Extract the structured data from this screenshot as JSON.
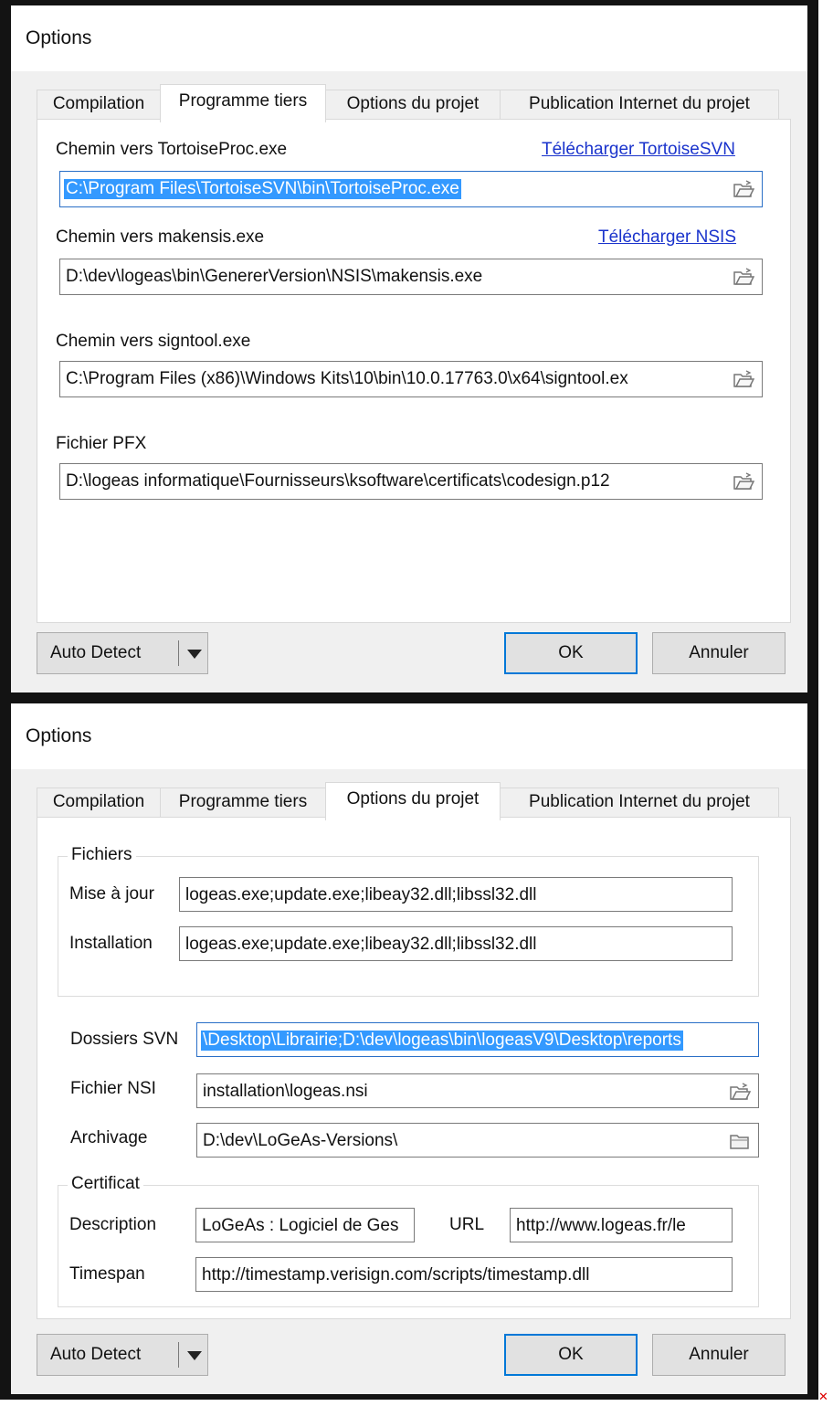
{
  "windows": [
    {
      "title": "Options",
      "tabs": [
        "Compilation",
        "Programme tiers",
        "Options du projet",
        "Publication Internet du projet"
      ],
      "active_tab": "Programme tiers",
      "fields": [
        {
          "label": "Chemin vers TortoiseProc.exe",
          "link": "Télécharger TortoiseSVN",
          "value": "C:\\Program Files\\TortoiseSVN\\bin\\TortoiseProc.exe",
          "icon": "open-file-icon"
        },
        {
          "label": "Chemin vers makensis.exe",
          "link": "Télécharger NSIS",
          "value": "D:\\dev\\logeas\\bin\\GenererVersion\\NSIS\\makensis.exe",
          "icon": "open-file-icon"
        },
        {
          "label": "Chemin vers signtool.exe",
          "value": "C:\\Program Files (x86)\\Windows Kits\\10\\bin\\10.0.17763.0\\x64\\signtool.ex",
          "icon": "open-file-icon"
        },
        {
          "label": "Fichier PFX",
          "value": "D:\\logeas informatique\\Fournisseurs\\ksoftware\\certificats\\codesign.p12",
          "icon": "open-file-icon"
        }
      ],
      "buttons": {
        "auto_detect": "Auto Detect",
        "ok": "OK",
        "cancel": "Annuler"
      }
    },
    {
      "title": "Options",
      "tabs": [
        "Compilation",
        "Programme tiers",
        "Options du projet",
        "Publication Internet du projet"
      ],
      "active_tab": "Options du projet",
      "fichiers": {
        "title": "Fichiers",
        "mise_a_jour_label": "Mise à jour",
        "mise_a_jour_value": "logeas.exe;update.exe;libeay32.dll;libssl32.dll",
        "installation_label": "Installation",
        "installation_value": "logeas.exe;update.exe;libeay32.dll;libssl32.dll"
      },
      "dossiers_svn_label": "Dossiers SVN",
      "dossiers_svn_value": "\\Desktop\\Librairie;D:\\dev\\logeas\\bin\\logeasV9\\Desktop\\reports",
      "fichier_nsi_label": "Fichier NSI",
      "fichier_nsi_value": "installation\\logeas.nsi",
      "archivage_label": "Archivage",
      "archivage_value": "D:\\dev\\LoGeAs-Versions\\",
      "certificat": {
        "title": "Certificat",
        "description_label": "Description",
        "description_value": "LoGeAs : Logiciel de Ges",
        "url_label": "URL",
        "url_value": "http://www.logeas.fr/le",
        "timespan_label": "Timespan",
        "timespan_value": "http://timestamp.verisign.com/scripts/timestamp.dll"
      },
      "buttons": {
        "auto_detect": "Auto Detect",
        "ok": "OK",
        "cancel": "Annuler"
      }
    }
  ],
  "colors": {
    "accent": "#0078d7",
    "link": "#1a33cc",
    "selection": "#3399ff",
    "frame": "#131313"
  }
}
